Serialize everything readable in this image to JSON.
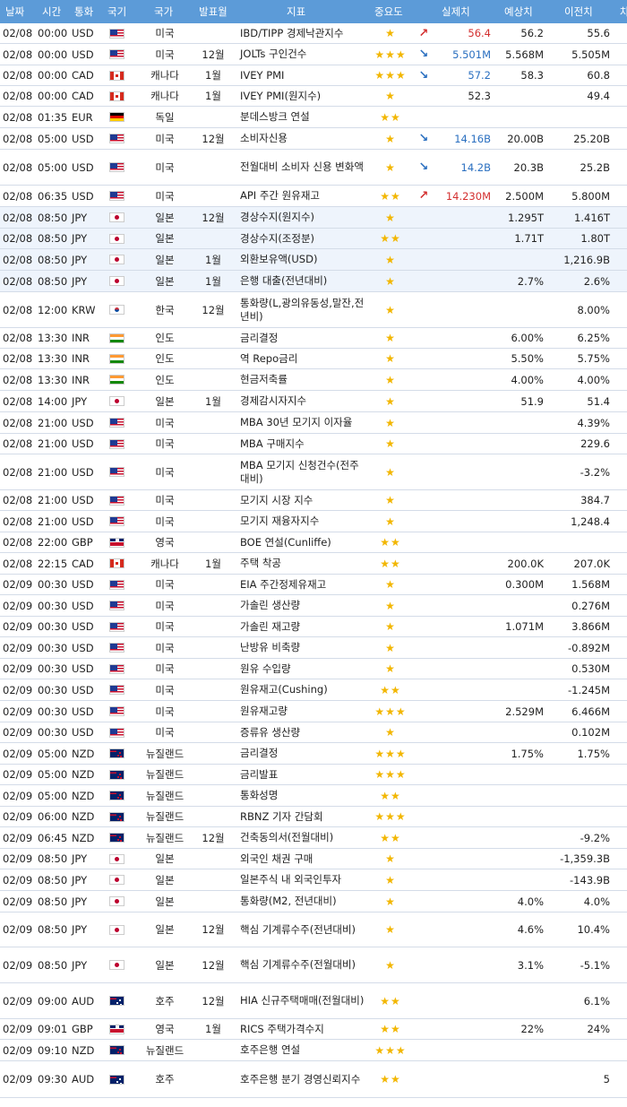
{
  "headers": [
    "날짜",
    "시간",
    "통화",
    "국기",
    "국가",
    "발표월",
    "지표",
    "중요도",
    "실제치",
    "예상치",
    "이전치",
    "차"
  ],
  "colors": {
    "header_bg": "#5c9bd8",
    "star": "#f2b600",
    "up": "#d32f2f",
    "down": "#2a6fc0"
  },
  "rows": [
    {
      "date": "02/08",
      "time": "00:00",
      "cur": "USD",
      "flag": "us",
      "country": "미국",
      "period": "",
      "ind": "IBD/TIPP 경제낙관지수",
      "stars": "★",
      "arrow": "↗",
      "dir": "up",
      "act": "56.4",
      "fc": "56.2",
      "pr": "55.6"
    },
    {
      "date": "02/08",
      "time": "00:00",
      "cur": "USD",
      "flag": "us",
      "country": "미국",
      "period": "12월",
      "ind": "JOLTs 구인건수",
      "stars": "★★★",
      "arrow": "↘",
      "dir": "down",
      "act": "5.501M",
      "fc": "5.568M",
      "pr": "5.505M"
    },
    {
      "date": "02/08",
      "time": "00:00",
      "cur": "CAD",
      "flag": "ca",
      "country": "캐나다",
      "period": "1월",
      "ind": "IVEY PMI",
      "stars": "★★★",
      "arrow": "↘",
      "dir": "down",
      "act": "57.2",
      "fc": "58.3",
      "pr": "60.8"
    },
    {
      "date": "02/08",
      "time": "00:00",
      "cur": "CAD",
      "flag": "ca",
      "country": "캐나다",
      "period": "1월",
      "ind": "IVEY PMI(원지수)",
      "stars": "★",
      "arrow": "",
      "dir": "",
      "act": "52.3",
      "fc": "",
      "pr": "49.4"
    },
    {
      "date": "02/08",
      "time": "01:35",
      "cur": "EUR",
      "flag": "de",
      "country": "독일",
      "period": "",
      "ind": "분데스방크 연설",
      "stars": "★★",
      "arrow": "",
      "dir": "",
      "act": "",
      "fc": "",
      "pr": ""
    },
    {
      "date": "02/08",
      "time": "05:00",
      "cur": "USD",
      "flag": "us",
      "country": "미국",
      "period": "12월",
      "ind": "소비자신용",
      "stars": "★",
      "arrow": "↘",
      "dir": "down",
      "act": "14.16B",
      "fc": "20.00B",
      "pr": "25.20B"
    },
    {
      "date": "02/08",
      "time": "05:00",
      "cur": "USD",
      "flag": "us",
      "country": "미국",
      "period": "",
      "ind": "전월대비 소비자 신용 변화액",
      "stars": "★",
      "arrow": "↘",
      "dir": "down",
      "act": "14.2B",
      "fc": "20.3B",
      "pr": "25.2B"
    },
    {
      "date": "02/08",
      "time": "06:35",
      "cur": "USD",
      "flag": "us",
      "country": "미국",
      "period": "",
      "ind": "API 주간 원유재고",
      "stars": "★★",
      "arrow": "↗",
      "dir": "up",
      "act": "14.230M",
      "fc": "2.500M",
      "pr": "5.800M"
    },
    {
      "date": "02/08",
      "time": "08:50",
      "cur": "JPY",
      "flag": "jp",
      "country": "일본",
      "period": "12월",
      "ind": "경상수지(원지수)",
      "stars": "★",
      "arrow": "",
      "dir": "",
      "act": "",
      "fc": "1.295T",
      "pr": "1.416T"
    },
    {
      "date": "02/08",
      "time": "08:50",
      "cur": "JPY",
      "flag": "jp",
      "country": "일본",
      "period": "",
      "ind": "경상수지(조정분)",
      "stars": "★★",
      "arrow": "",
      "dir": "",
      "act": "",
      "fc": "1.71T",
      "pr": "1.80T"
    },
    {
      "date": "02/08",
      "time": "08:50",
      "cur": "JPY",
      "flag": "jp",
      "country": "일본",
      "period": "1월",
      "ind": "외환보유액(USD)",
      "stars": "★",
      "arrow": "",
      "dir": "",
      "act": "",
      "fc": "",
      "pr": "1,216.9B"
    },
    {
      "date": "02/08",
      "time": "08:50",
      "cur": "JPY",
      "flag": "jp",
      "country": "일본",
      "period": "1월",
      "ind": "은행 대출(전년대비)",
      "stars": "★",
      "arrow": "",
      "dir": "",
      "act": "",
      "fc": "2.7%",
      "pr": "2.6%"
    },
    {
      "date": "02/08",
      "time": "12:00",
      "cur": "KRW",
      "flag": "kr",
      "country": "한국",
      "period": "12월",
      "ind": "통화량(L,광의유동성,말잔,전년비)",
      "stars": "★",
      "arrow": "",
      "dir": "",
      "act": "",
      "fc": "",
      "pr": "8.00%"
    },
    {
      "date": "02/08",
      "time": "13:30",
      "cur": "INR",
      "flag": "in",
      "country": "인도",
      "period": "",
      "ind": "금리결정",
      "stars": "★",
      "arrow": "",
      "dir": "",
      "act": "",
      "fc": "6.00%",
      "pr": "6.25%"
    },
    {
      "date": "02/08",
      "time": "13:30",
      "cur": "INR",
      "flag": "in",
      "country": "인도",
      "period": "",
      "ind": "역 Repo금리",
      "stars": "★",
      "arrow": "",
      "dir": "",
      "act": "",
      "fc": "5.50%",
      "pr": "5.75%"
    },
    {
      "date": "02/08",
      "time": "13:30",
      "cur": "INR",
      "flag": "in",
      "country": "인도",
      "period": "",
      "ind": "현금저축률",
      "stars": "★",
      "arrow": "",
      "dir": "",
      "act": "",
      "fc": "4.00%",
      "pr": "4.00%"
    },
    {
      "date": "02/08",
      "time": "14:00",
      "cur": "JPY",
      "flag": "jp",
      "country": "일본",
      "period": "1월",
      "ind": "경제감시자지수",
      "stars": "★",
      "arrow": "",
      "dir": "",
      "act": "",
      "fc": "51.9",
      "pr": "51.4"
    },
    {
      "date": "02/08",
      "time": "21:00",
      "cur": "USD",
      "flag": "us",
      "country": "미국",
      "period": "",
      "ind": "MBA 30년 모기지 이자율",
      "stars": "★",
      "arrow": "",
      "dir": "",
      "act": "",
      "fc": "",
      "pr": "4.39%"
    },
    {
      "date": "02/08",
      "time": "21:00",
      "cur": "USD",
      "flag": "us",
      "country": "미국",
      "period": "",
      "ind": "MBA 구매지수",
      "stars": "★",
      "arrow": "",
      "dir": "",
      "act": "",
      "fc": "",
      "pr": "229.6"
    },
    {
      "date": "02/08",
      "time": "21:00",
      "cur": "USD",
      "flag": "us",
      "country": "미국",
      "period": "",
      "ind": "MBA 모기지 신청건수(전주대비)",
      "stars": "★",
      "arrow": "",
      "dir": "",
      "act": "",
      "fc": "",
      "pr": "-3.2%"
    },
    {
      "date": "02/08",
      "time": "21:00",
      "cur": "USD",
      "flag": "us",
      "country": "미국",
      "period": "",
      "ind": "모기지 시장 지수",
      "stars": "★",
      "arrow": "",
      "dir": "",
      "act": "",
      "fc": "",
      "pr": "384.7"
    },
    {
      "date": "02/08",
      "time": "21:00",
      "cur": "USD",
      "flag": "us",
      "country": "미국",
      "period": "",
      "ind": "모기지 재융자지수",
      "stars": "★",
      "arrow": "",
      "dir": "",
      "act": "",
      "fc": "",
      "pr": "1,248.4"
    },
    {
      "date": "02/08",
      "time": "22:00",
      "cur": "GBP",
      "flag": "gb",
      "country": "영국",
      "period": "",
      "ind": "BOE 연설(Cunliffe)",
      "stars": "★★",
      "arrow": "",
      "dir": "",
      "act": "",
      "fc": "",
      "pr": ""
    },
    {
      "date": "02/08",
      "time": "22:15",
      "cur": "CAD",
      "flag": "ca",
      "country": "캐나다",
      "period": "1월",
      "ind": "주택 착공",
      "stars": "★★",
      "arrow": "",
      "dir": "",
      "act": "",
      "fc": "200.0K",
      "pr": "207.0K"
    },
    {
      "date": "02/09",
      "time": "00:30",
      "cur": "USD",
      "flag": "us",
      "country": "미국",
      "period": "",
      "ind": "EIA 주간정제유재고",
      "stars": "★",
      "arrow": "",
      "dir": "",
      "act": "",
      "fc": "0.300M",
      "pr": "1.568M"
    },
    {
      "date": "02/09",
      "time": "00:30",
      "cur": "USD",
      "flag": "us",
      "country": "미국",
      "period": "",
      "ind": "가솔린 생산량",
      "stars": "★",
      "arrow": "",
      "dir": "",
      "act": "",
      "fc": "",
      "pr": "0.276M"
    },
    {
      "date": "02/09",
      "time": "00:30",
      "cur": "USD",
      "flag": "us",
      "country": "미국",
      "period": "",
      "ind": "가솔린 재고량",
      "stars": "★",
      "arrow": "",
      "dir": "",
      "act": "",
      "fc": "1.071M",
      "pr": "3.866M"
    },
    {
      "date": "02/09",
      "time": "00:30",
      "cur": "USD",
      "flag": "us",
      "country": "미국",
      "period": "",
      "ind": "난방유 비축량",
      "stars": "★",
      "arrow": "",
      "dir": "",
      "act": "",
      "fc": "",
      "pr": "-0.892M"
    },
    {
      "date": "02/09",
      "time": "00:30",
      "cur": "USD",
      "flag": "us",
      "country": "미국",
      "period": "",
      "ind": "원유 수입량",
      "stars": "★",
      "arrow": "",
      "dir": "",
      "act": "",
      "fc": "",
      "pr": "0.530M"
    },
    {
      "date": "02/09",
      "time": "00:30",
      "cur": "USD",
      "flag": "us",
      "country": "미국",
      "period": "",
      "ind": "원유재고(Cushing)",
      "stars": "★★",
      "arrow": "",
      "dir": "",
      "act": "",
      "fc": "",
      "pr": "-1.245M"
    },
    {
      "date": "02/09",
      "time": "00:30",
      "cur": "USD",
      "flag": "us",
      "country": "미국",
      "period": "",
      "ind": "원유재고량",
      "stars": "★★★",
      "arrow": "",
      "dir": "",
      "act": "",
      "fc": "2.529M",
      "pr": "6.466M"
    },
    {
      "date": "02/09",
      "time": "00:30",
      "cur": "USD",
      "flag": "us",
      "country": "미국",
      "period": "",
      "ind": "증류유 생산량",
      "stars": "★",
      "arrow": "",
      "dir": "",
      "act": "",
      "fc": "",
      "pr": "0.102M"
    },
    {
      "date": "02/09",
      "time": "05:00",
      "cur": "NZD",
      "flag": "nz",
      "country": "뉴질랜드",
      "period": "",
      "ind": "금리결정",
      "stars": "★★★",
      "arrow": "",
      "dir": "",
      "act": "",
      "fc": "1.75%",
      "pr": "1.75%"
    },
    {
      "date": "02/09",
      "time": "05:00",
      "cur": "NZD",
      "flag": "nz",
      "country": "뉴질랜드",
      "period": "",
      "ind": "금리발표",
      "stars": "★★★",
      "arrow": "",
      "dir": "",
      "act": "",
      "fc": "",
      "pr": ""
    },
    {
      "date": "02/09",
      "time": "05:00",
      "cur": "NZD",
      "flag": "nz",
      "country": "뉴질랜드",
      "period": "",
      "ind": "통화성명",
      "stars": "★★",
      "arrow": "",
      "dir": "",
      "act": "",
      "fc": "",
      "pr": ""
    },
    {
      "date": "02/09",
      "time": "06:00",
      "cur": "NZD",
      "flag": "nz",
      "country": "뉴질랜드",
      "period": "",
      "ind": "RBNZ 기자 간담회",
      "stars": "★★★",
      "arrow": "",
      "dir": "",
      "act": "",
      "fc": "",
      "pr": ""
    },
    {
      "date": "02/09",
      "time": "06:45",
      "cur": "NZD",
      "flag": "nz",
      "country": "뉴질랜드",
      "period": "12월",
      "ind": "건축동의서(전월대비)",
      "stars": "★★",
      "arrow": "",
      "dir": "",
      "act": "",
      "fc": "",
      "pr": "-9.2%"
    },
    {
      "date": "02/09",
      "time": "08:50",
      "cur": "JPY",
      "flag": "jp",
      "country": "일본",
      "period": "",
      "ind": "외국인 채권 구매",
      "stars": "★",
      "arrow": "",
      "dir": "",
      "act": "",
      "fc": "",
      "pr": "-1,359.3B"
    },
    {
      "date": "02/09",
      "time": "08:50",
      "cur": "JPY",
      "flag": "jp",
      "country": "일본",
      "period": "",
      "ind": "일본주식 내 외국인투자",
      "stars": "★",
      "arrow": "",
      "dir": "",
      "act": "",
      "fc": "",
      "pr": "-143.9B"
    },
    {
      "date": "02/09",
      "time": "08:50",
      "cur": "JPY",
      "flag": "jp",
      "country": "일본",
      "period": "",
      "ind": "통화량(M2, 전년대비)",
      "stars": "★",
      "arrow": "",
      "dir": "",
      "act": "",
      "fc": "4.0%",
      "pr": "4.0%"
    },
    {
      "date": "02/09",
      "time": "08:50",
      "cur": "JPY",
      "flag": "jp",
      "country": "일본",
      "period": "12월",
      "ind": "핵심 기계류수주(전년대비)",
      "stars": "★",
      "arrow": "",
      "dir": "",
      "act": "",
      "fc": "4.6%",
      "pr": "10.4%"
    },
    {
      "date": "02/09",
      "time": "08:50",
      "cur": "JPY",
      "flag": "jp",
      "country": "일본",
      "period": "12월",
      "ind": "핵심 기계류수주(전월대비)",
      "stars": "★",
      "arrow": "",
      "dir": "",
      "act": "",
      "fc": "3.1%",
      "pr": "-5.1%"
    },
    {
      "date": "02/09",
      "time": "09:00",
      "cur": "AUD",
      "flag": "au",
      "country": "호주",
      "period": "12월",
      "ind": "HIA 신규주택매매(전월대비)",
      "stars": "★★",
      "arrow": "",
      "dir": "",
      "act": "",
      "fc": "",
      "pr": "6.1%"
    },
    {
      "date": "02/09",
      "time": "09:01",
      "cur": "GBP",
      "flag": "gb",
      "country": "영국",
      "period": "1월",
      "ind": "RICS 주택가격수지",
      "stars": "★★",
      "arrow": "",
      "dir": "",
      "act": "",
      "fc": "22%",
      "pr": "24%"
    },
    {
      "date": "02/09",
      "time": "09:10",
      "cur": "NZD",
      "flag": "nz",
      "country": "뉴질랜드",
      "period": "",
      "ind": "호주은행 연설",
      "stars": "★★★",
      "arrow": "",
      "dir": "",
      "act": "",
      "fc": "",
      "pr": ""
    },
    {
      "date": "02/09",
      "time": "09:30",
      "cur": "AUD",
      "flag": "au",
      "country": "호주",
      "period": "",
      "ind": "호주은행 분기 경영신뢰지수",
      "stars": "★★",
      "arrow": "",
      "dir": "",
      "act": "",
      "fc": "",
      "pr": "5"
    }
  ]
}
